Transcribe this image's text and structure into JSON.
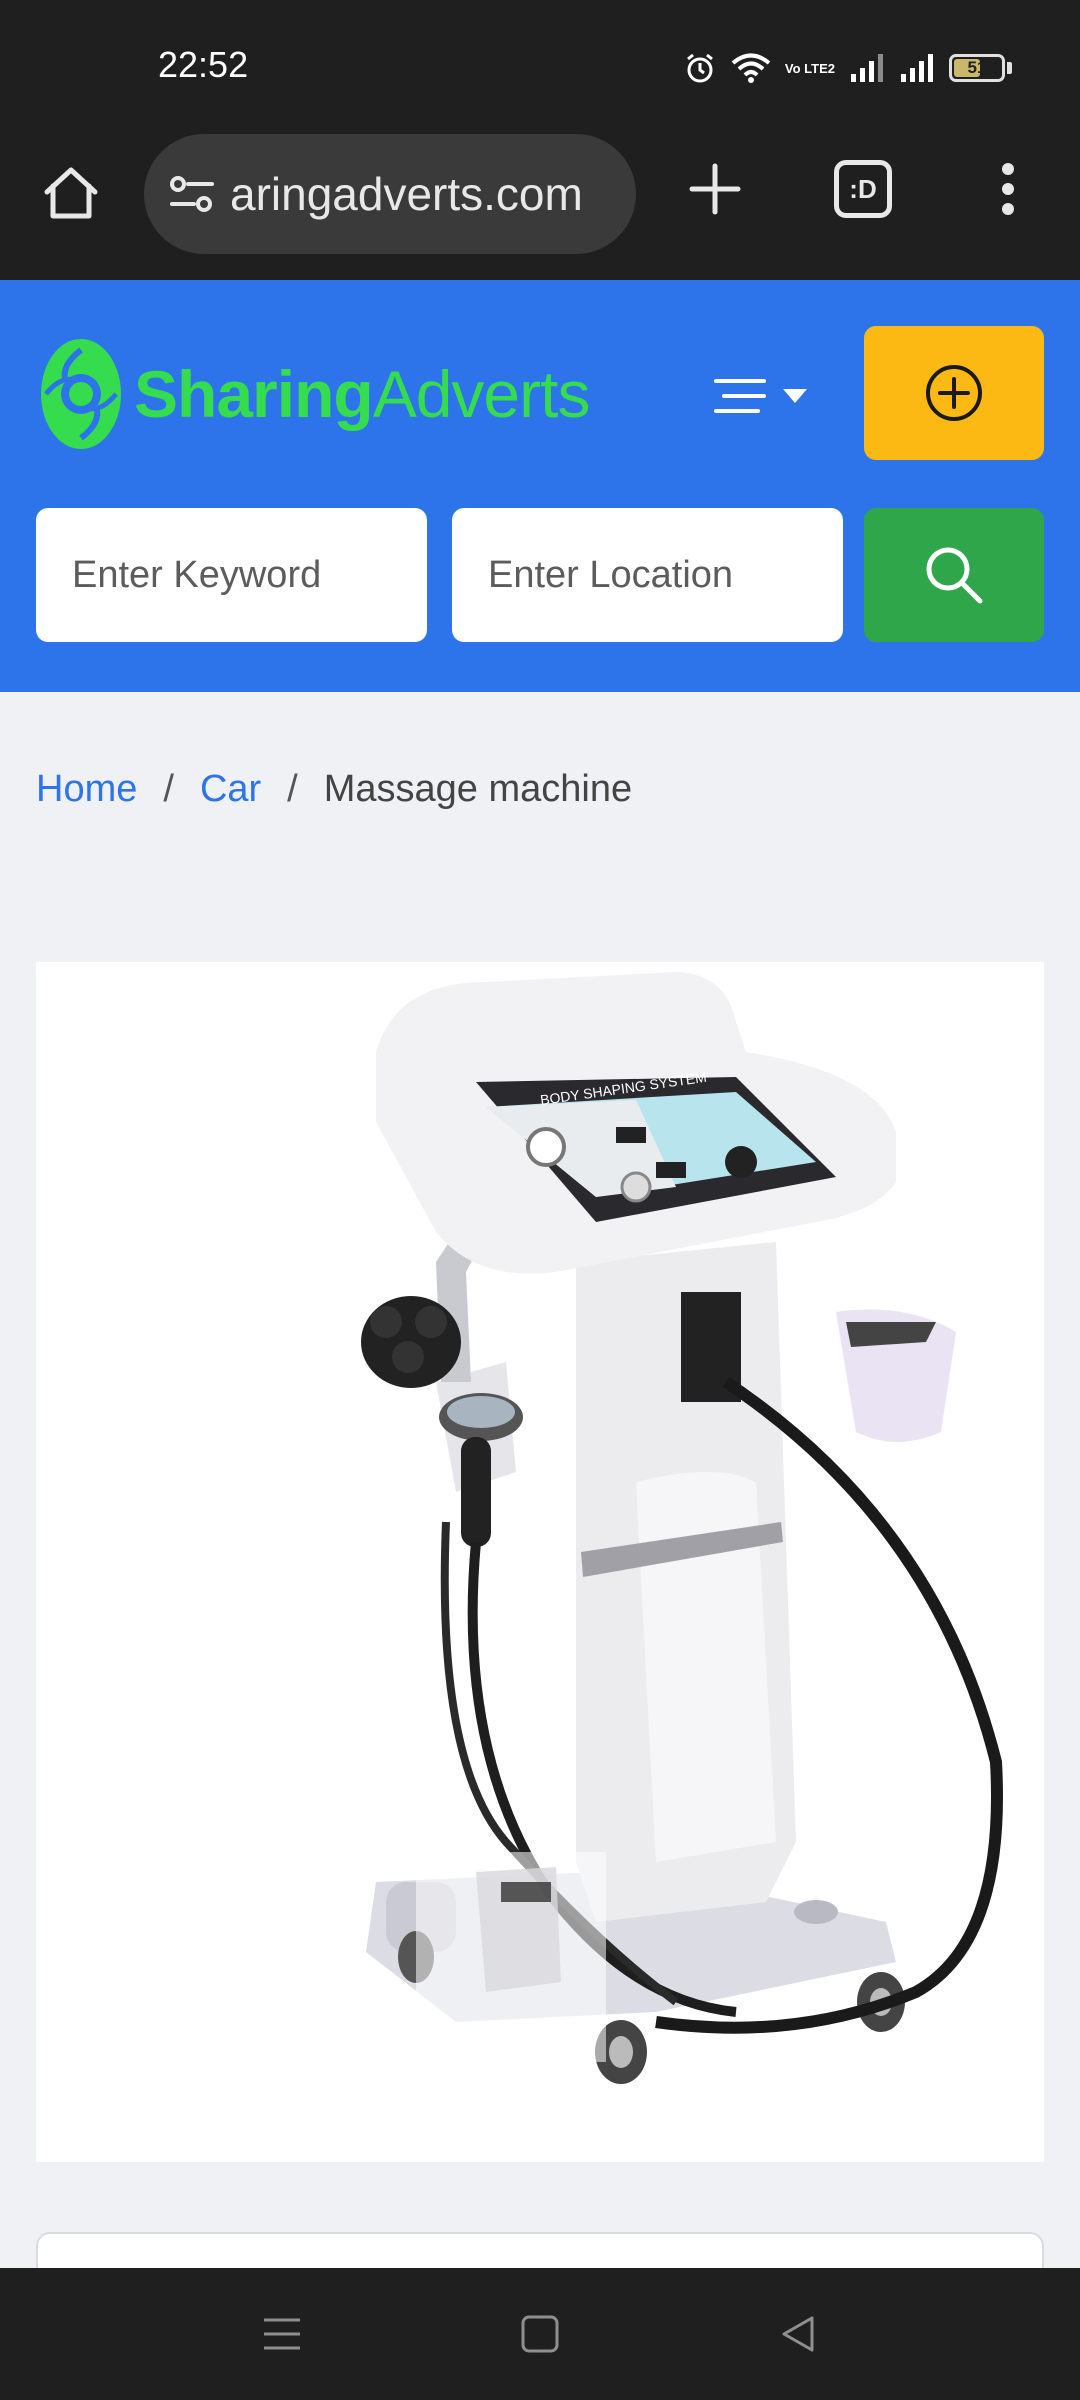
{
  "status_bar": {
    "time": "22:52",
    "battery_level": "51",
    "network_label": "Vo LTE2",
    "icons": [
      "alarm-icon",
      "wifi-icon",
      "volte-icon",
      "signal-icon",
      "signal-icon",
      "battery-icon"
    ]
  },
  "browser": {
    "url": "aringadverts.com",
    "tabs_label": ":D",
    "icons": [
      "home-icon",
      "site-settings-icon",
      "plus-icon",
      "tabs-icon",
      "more-vert-icon"
    ]
  },
  "header": {
    "logo_bold": "Sharing",
    "logo_light": "Adverts",
    "brand_color": "#2d74ea",
    "logo_color": "#34dc4e",
    "post_button_color": "#fdb913",
    "search_button_color": "#2fa64a"
  },
  "search": {
    "keyword_placeholder": "Enter Keyword",
    "location_placeholder": "Enter Location"
  },
  "breadcrumb": {
    "home": "Home",
    "category": "Car",
    "current": "Massage machine",
    "separator": "/"
  },
  "product": {
    "panel_label": "BODY SHAPING SYSTEM"
  }
}
